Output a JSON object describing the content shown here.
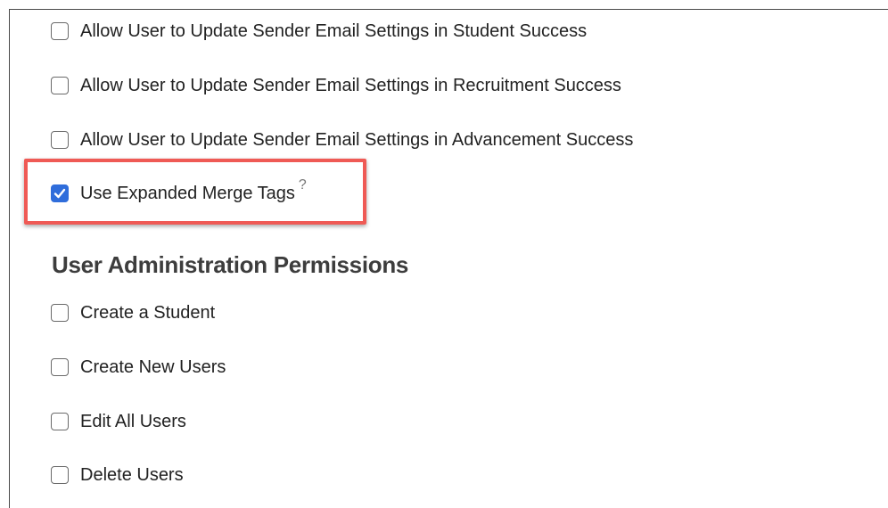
{
  "email_settings": {
    "items": [
      {
        "label": "Allow User to Update Sender Email Settings in Student Success",
        "checked": false
      },
      {
        "label": "Allow User to Update Sender Email Settings in Recruitment Success",
        "checked": false
      },
      {
        "label": "Allow User to Update Sender Email Settings in Advancement Success",
        "checked": false
      },
      {
        "label": "Use Expanded Merge Tags",
        "checked": true,
        "help": "?"
      }
    ]
  },
  "user_admin": {
    "heading": "User Administration Permissions",
    "items": [
      {
        "label": "Create a Student",
        "checked": false
      },
      {
        "label": "Create New Users",
        "checked": false
      },
      {
        "label": "Edit All Users",
        "checked": false
      },
      {
        "label": "Delete Users",
        "checked": false
      }
    ]
  },
  "colors": {
    "checkbox_checked": "#2f6ddb",
    "highlight_border": "#ef5a55",
    "heading_text": "#3d3d3d"
  }
}
